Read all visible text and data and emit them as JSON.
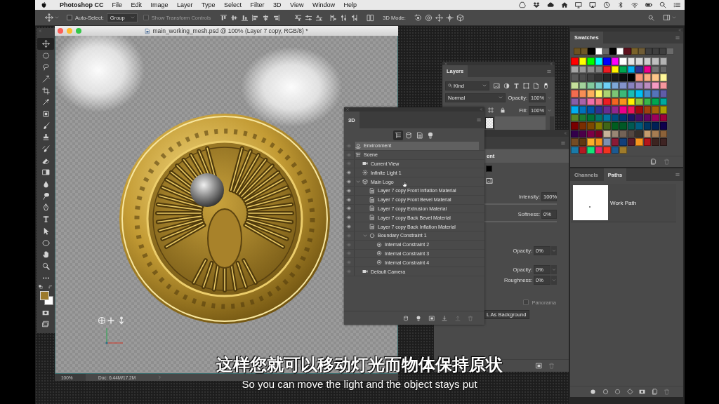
{
  "menu_bar": {
    "app_name": "Photoshop CC",
    "menus": [
      "File",
      "Edit",
      "Image",
      "Layer",
      "Type",
      "Select",
      "Filter",
      "3D",
      "View",
      "Window",
      "Help"
    ]
  },
  "options_bar": {
    "auto_select": {
      "label": "Auto-Select:",
      "checked": false
    },
    "auto_select_target": "Group",
    "transform_controls": {
      "label": "Show Transform Controls",
      "checked": false,
      "disabled": true
    },
    "mode_label": "3D Mode:"
  },
  "tools": [
    {
      "kind": "move",
      "selected": true
    },
    {
      "kind": "marquee",
      "selected": false
    },
    {
      "kind": "lasso",
      "selected": false
    },
    {
      "kind": "magic-wand",
      "selected": false
    },
    {
      "kind": "crop",
      "selected": false
    },
    {
      "kind": "eyedropper",
      "selected": false
    },
    {
      "kind": "patch",
      "selected": false
    },
    {
      "kind": "brush",
      "selected": false
    },
    {
      "kind": "stamp",
      "selected": false
    },
    {
      "kind": "history-brush",
      "selected": false
    },
    {
      "kind": "eraser",
      "selected": false
    },
    {
      "kind": "gradient",
      "selected": false
    },
    {
      "kind": "blur",
      "selected": false
    },
    {
      "kind": "dodge",
      "selected": false
    },
    {
      "kind": "pen",
      "selected": false
    },
    {
      "kind": "type",
      "selected": false
    },
    {
      "kind": "path-select",
      "selected": false
    },
    {
      "kind": "ellipse",
      "selected": false
    },
    {
      "kind": "hand",
      "selected": false
    },
    {
      "kind": "zoom",
      "selected": false
    },
    {
      "kind": "more",
      "selected": false
    }
  ],
  "document": {
    "title": "main_working_mesh.psd @ 100% (Layer 7 copy, RGB/8) *",
    "zoom": "100%",
    "doc_size": "Doc: 6.44M/17.2M"
  },
  "layers_panel": {
    "tab": "Layers",
    "filter": "Kind",
    "blend_mode": "Normal",
    "opacity_label": "Opacity:",
    "opacity": "100%",
    "fill_label": "Fill:",
    "fill": "100%"
  },
  "properties_panel": {
    "heading": "ent",
    "sections": [
      {
        "fields": [
          {
            "kind": "slider",
            "label": "Intensity:",
            "value": "100%"
          },
          {
            "kind": "slider",
            "label": "Softness:",
            "value": "0%"
          }
        ]
      },
      {
        "fields": [
          {
            "kind": "dropdown",
            "label": "Opacity:",
            "value": "0%"
          }
        ]
      },
      {
        "fields": [
          {
            "kind": "dropdown",
            "label": "Opacity:",
            "value": "0%"
          },
          {
            "kind": "dropdown",
            "label": "Roughness:",
            "value": "0%"
          }
        ]
      }
    ],
    "panorama": {
      "label": "Panorama",
      "checked": false,
      "disabled": true
    },
    "background_button": "L As Background"
  },
  "panel_3d": {
    "tab": "3D",
    "filters": [
      {
        "kind": "scene",
        "selected": true
      },
      {
        "kind": "mesh",
        "selected": false
      },
      {
        "kind": "material",
        "selected": false
      },
      {
        "kind": "light",
        "selected": false
      }
    ],
    "items": [
      {
        "kind": "environment",
        "name": "Environment",
        "eye_active": false,
        "selected": true
      },
      {
        "kind": "scene",
        "name": "Scene",
        "eye_active": false,
        "selected": false,
        "children": [
          {
            "kind": "camera",
            "name": "Current View",
            "eye_active": false,
            "selected": false
          },
          {
            "kind": "light",
            "name": "Infinite Light 1",
            "eye_active": true,
            "selected": false
          },
          {
            "kind": "mesh",
            "name": "Main Logo",
            "eye_active": true,
            "selected": false,
            "expanded": true,
            "children": [
              {
                "kind": "material",
                "name": "Layer 7 copy Front Inflation Material",
                "eye_active": true,
                "selected": false
              },
              {
                "kind": "material",
                "name": "Layer 7 copy Front Bevel Material",
                "eye_active": true,
                "selected": false
              },
              {
                "kind": "material",
                "name": "Layer 7 copy Extrusion Material",
                "eye_active": true,
                "selected": false
              },
              {
                "kind": "material",
                "name": "Layer 7 copy Back Bevel Material",
                "eye_active": true,
                "selected": false
              },
              {
                "kind": "material",
                "name": "Layer 7 copy Back Inflation Material",
                "eye_active": true,
                "selected": false
              },
              {
                "kind": "boundary",
                "name": "Boundary Constraint 1",
                "eye_active": false,
                "selected": false,
                "expanded": true,
                "children": [
                  {
                    "kind": "internal",
                    "name": "Internal Constraint 2",
                    "eye_active": false,
                    "selected": false
                  },
                  {
                    "kind": "internal",
                    "name": "Internal Constraint 3",
                    "eye_active": false,
                    "selected": false
                  },
                  {
                    "kind": "internal",
                    "name": "Internal Constraint 4",
                    "eye_active": false,
                    "selected": false
                  }
                ]
              }
            ]
          },
          {
            "kind": "camera",
            "name": "Default Camera",
            "eye_active": false,
            "selected": false
          }
        ]
      }
    ]
  },
  "swatches_panel": {
    "tab": "Swatches",
    "recent": [
      {
        "color": "#6b5321"
      },
      {
        "color": "#6e5727"
      },
      {
        "color": "#000000"
      },
      {
        "color": "#ffffff"
      },
      {
        "color": "#6a6a6a"
      },
      {
        "color": "#000000"
      },
      {
        "color": "#ffffff"
      },
      {
        "color": "#5c111d"
      },
      {
        "color": "#7a6229"
      },
      {
        "color": "#6f5c36"
      },
      {
        "color": "#3f3f3f"
      },
      {
        "color": "#3f3f3f"
      },
      {
        "color": "#3f3f3f"
      },
      {
        "color": "#6b6b6b"
      }
    ],
    "swatches": [
      {
        "color": "#ff0000"
      },
      {
        "color": "#ffff00"
      },
      {
        "color": "#00ff00"
      },
      {
        "color": "#00ffff"
      },
      {
        "color": "#0000ff"
      },
      {
        "color": "#ff00ff"
      },
      {
        "color": "#ffffff"
      },
      {
        "color": "#e6e6e6"
      },
      {
        "color": "#d9d9d9"
      },
      {
        "color": "#cccccc"
      },
      {
        "color": "#bfbfbf"
      },
      {
        "color": "#b3b3b3"
      },
      {
        "color": "#a6a6a6"
      },
      {
        "color": "#999999"
      },
      {
        "color": "#8c8c8c"
      },
      {
        "color": "#808080"
      },
      {
        "color": "#ed1c24"
      },
      {
        "color": "#fff200"
      },
      {
        "color": "#00a651"
      },
      {
        "color": "#00aeef"
      },
      {
        "color": "#2e3192"
      },
      {
        "color": "#ec008c"
      },
      {
        "color": "#737373"
      },
      {
        "color": "#666666"
      },
      {
        "color": "#595959"
      },
      {
        "color": "#4d4d4d"
      },
      {
        "color": "#404040"
      },
      {
        "color": "#333333"
      },
      {
        "color": "#262626"
      },
      {
        "color": "#1a1a1a"
      },
      {
        "color": "#0d0d0d"
      },
      {
        "color": "#000000"
      },
      {
        "color": "#f7977a"
      },
      {
        "color": "#f9ad81"
      },
      {
        "color": "#fdc68a"
      },
      {
        "color": "#fff79a"
      },
      {
        "color": "#c4df9b"
      },
      {
        "color": "#a3d39c"
      },
      {
        "color": "#82ca9d"
      },
      {
        "color": "#7bcdc8"
      },
      {
        "color": "#6ecff6"
      },
      {
        "color": "#7ea7d8"
      },
      {
        "color": "#8493ca"
      },
      {
        "color": "#8882be"
      },
      {
        "color": "#a187be"
      },
      {
        "color": "#bc8dbf"
      },
      {
        "color": "#f49ac2"
      },
      {
        "color": "#f6989d"
      },
      {
        "color": "#f26c4f"
      },
      {
        "color": "#f68e55"
      },
      {
        "color": "#fbaf5c"
      },
      {
        "color": "#fff467"
      },
      {
        "color": "#acd372"
      },
      {
        "color": "#7cc576"
      },
      {
        "color": "#3bb878"
      },
      {
        "color": "#1abbb4"
      },
      {
        "color": "#00bff3"
      },
      {
        "color": "#438ccb"
      },
      {
        "color": "#5574b9"
      },
      {
        "color": "#605ca8"
      },
      {
        "color": "#855fa8"
      },
      {
        "color": "#a763a8"
      },
      {
        "color": "#f06ea9"
      },
      {
        "color": "#f26d7d"
      },
      {
        "color": "#ed1c24"
      },
      {
        "color": "#f26522"
      },
      {
        "color": "#f7941d"
      },
      {
        "color": "#fff200"
      },
      {
        "color": "#8dc63f"
      },
      {
        "color": "#39b54a"
      },
      {
        "color": "#00a651"
      },
      {
        "color": "#00a99d"
      },
      {
        "color": "#00aeef"
      },
      {
        "color": "#0072bc"
      },
      {
        "color": "#0054a6"
      },
      {
        "color": "#2e3192"
      },
      {
        "color": "#662d91"
      },
      {
        "color": "#92278f"
      },
      {
        "color": "#ec008c"
      },
      {
        "color": "#ed145b"
      },
      {
        "color": "#9e0b0f"
      },
      {
        "color": "#a0410d"
      },
      {
        "color": "#a36209"
      },
      {
        "color": "#aba000"
      },
      {
        "color": "#598527"
      },
      {
        "color": "#1a7b30"
      },
      {
        "color": "#007236"
      },
      {
        "color": "#00746b"
      },
      {
        "color": "#0076a3"
      },
      {
        "color": "#004b80"
      },
      {
        "color": "#003471"
      },
      {
        "color": "#1b1464"
      },
      {
        "color": "#440e62"
      },
      {
        "color": "#630460"
      },
      {
        "color": "#9e005d"
      },
      {
        "color": "#9e0039"
      },
      {
        "color": "#790000"
      },
      {
        "color": "#7b2e00"
      },
      {
        "color": "#7d4900"
      },
      {
        "color": "#827b00"
      },
      {
        "color": "#406618"
      },
      {
        "color": "#005e20"
      },
      {
        "color": "#005826"
      },
      {
        "color": "#005952"
      },
      {
        "color": "#005b7f"
      },
      {
        "color": "#003663"
      },
      {
        "color": "#002157"
      },
      {
        "color": "#0d004c"
      },
      {
        "color": "#32004b"
      },
      {
        "color": "#4b0049"
      },
      {
        "color": "#7b0046"
      },
      {
        "color": "#7a0026"
      },
      {
        "color": "#c7b299"
      },
      {
        "color": "#998675"
      },
      {
        "color": "#736357"
      },
      {
        "color": "#534741"
      },
      {
        "color": "#37302a"
      },
      {
        "color": "#c69c6d"
      },
      {
        "color": "#a67c52"
      },
      {
        "color": "#8c6239"
      },
      {
        "color": "#754c24"
      },
      {
        "color": "#603913"
      },
      {
        "color": "#fbaf2a"
      },
      {
        "color": "#f7941d"
      },
      {
        "color": "#7d91b0"
      },
      {
        "color": "#8b1a36"
      },
      {
        "color": "#123f7a"
      },
      {
        "color": "#5b1a2b"
      },
      {
        "color": "#f7941d"
      },
      {
        "color": "#b2151b"
      },
      {
        "color": "#3c2420"
      },
      {
        "color": "#3e2423"
      },
      {
        "color": "#1a7aa8"
      },
      {
        "color": "#b51a22"
      },
      {
        "color": "#14e57a"
      },
      {
        "color": "#e2256d"
      },
      {
        "color": "#f2331f"
      },
      {
        "color": "#1c5a92"
      },
      {
        "color": "#9f7b2a"
      }
    ]
  },
  "paths_panel": {
    "tabs": [
      {
        "label": "Channels",
        "selected": false
      },
      {
        "label": "Paths",
        "selected": true
      }
    ],
    "paths": [
      {
        "name": "Work Path"
      }
    ]
  },
  "subtitles": {
    "primary": "这样您就可以移动灯光而物体保持原状",
    "secondary": "So you can move the light and the object stays put"
  }
}
